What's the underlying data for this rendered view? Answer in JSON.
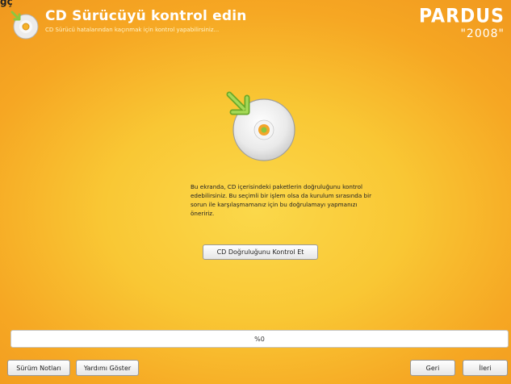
{
  "app": {
    "title": "CD Sürücüyü kontrol edin",
    "subtitle": "CD Sürücü hatalarından kaçınmak için kontrol yapabilirsiniz...",
    "corner_glyph": "ğç"
  },
  "logo": {
    "name": "Pardus",
    "word": "PARDUS",
    "year": "\"2008\""
  },
  "main": {
    "icon": "cd-check-icon",
    "description": "Bu ekranda, CD içerisindeki paketlerin doğruluğunu kontrol edebilirsiniz. Bu seçimli bir işlem olsa da kurulum sırasında bir sorun ile karşılaşmamanız için bu doğrulamayı yapmanızı öneririz.",
    "verify_button": "CD Doğruluğunu Kontrol Et"
  },
  "progress": {
    "value": 0,
    "label": "%0"
  },
  "footer": {
    "release_notes": "Sürüm Notları",
    "show_help": "Yardımı Göster",
    "back": "Geri",
    "next": "İleri"
  },
  "colors": {
    "background_center": "#fbd84a",
    "background_edge": "#f19a1f",
    "arrow": "#8cc63f",
    "text_white": "#ffffff"
  }
}
